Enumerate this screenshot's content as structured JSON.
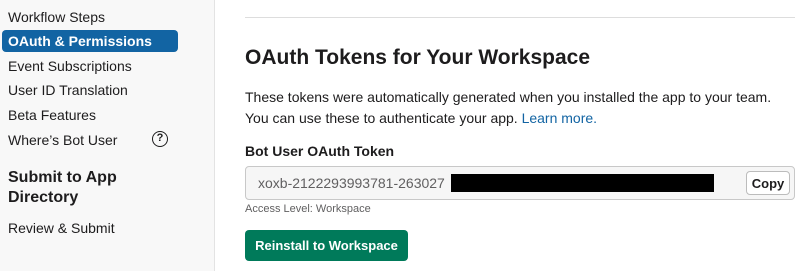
{
  "sidebar": {
    "items": [
      {
        "label": "Workflow Steps"
      },
      {
        "label": "OAuth & Permissions"
      },
      {
        "label": "Event Subscriptions"
      },
      {
        "label": "User ID Translation"
      },
      {
        "label": "Beta Features"
      },
      {
        "label": "Where’s Bot User",
        "icon": "help-circle-icon",
        "icon_glyph": "?"
      }
    ],
    "active_item": "OAuth & Permissions",
    "section_heading": "Submit to App Directory",
    "review_item": "Review & Submit"
  },
  "main": {
    "title": "OAuth Tokens for Your Workspace",
    "description": "These tokens were automatically generated when you installed the app to your team. You can use these to authenticate your app.",
    "learn_more_link": "Learn more.",
    "token": {
      "label": "Bot User OAuth Token",
      "value_prefix": "xoxb-2122293993781-263027",
      "redacted": true,
      "copy_button": "Copy",
      "access_level": "Access Level: Workspace"
    },
    "reinstall_button": "Reinstall to Workspace"
  },
  "colors": {
    "active_nav": "#1264a3",
    "link": "#1264a3",
    "primary_button": "#007a5a"
  }
}
